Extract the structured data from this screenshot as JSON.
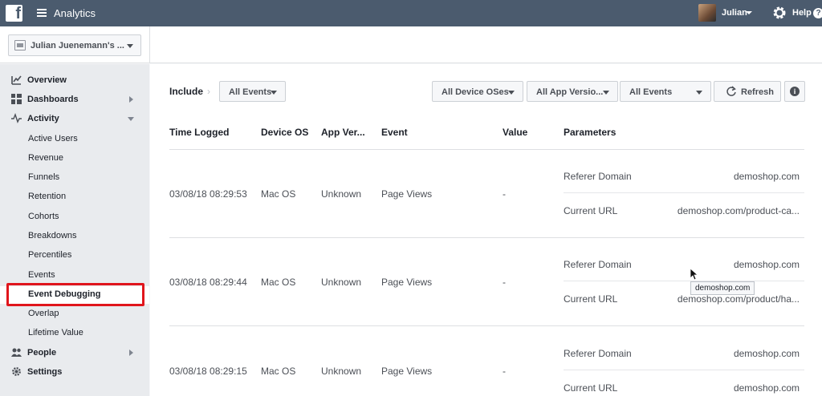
{
  "topbar": {
    "app_title": "Analytics",
    "user_name": "Julian",
    "help_label": "Help",
    "help_symbol": "?"
  },
  "account": {
    "name": "Julian Juenemann's ..."
  },
  "sidebar": {
    "items": [
      {
        "label": "Overview",
        "icon": "overview-icon"
      },
      {
        "label": "Dashboards",
        "icon": "dashboards-icon"
      },
      {
        "label": "Activity",
        "icon": "activity-icon"
      },
      {
        "label": "Active Users"
      },
      {
        "label": "Revenue"
      },
      {
        "label": "Funnels"
      },
      {
        "label": "Retention"
      },
      {
        "label": "Cohorts"
      },
      {
        "label": "Breakdowns"
      },
      {
        "label": "Percentiles"
      },
      {
        "label": "Events"
      },
      {
        "label": "Event Debugging",
        "active": true
      },
      {
        "label": "Overlap"
      },
      {
        "label": "Lifetime Value"
      },
      {
        "label": "People",
        "icon": "people-icon"
      },
      {
        "label": "Settings",
        "icon": "gear-icon"
      }
    ]
  },
  "filters": {
    "include_label": "Include",
    "include_arrow": "›",
    "all_events": "All Events",
    "device_os": "All Device OSes",
    "app_version": "All App Versio...",
    "events": "All Events",
    "refresh": "Refresh"
  },
  "table": {
    "headers": [
      "Time Logged",
      "Device OS",
      "App Ver...",
      "Event",
      "Value",
      "Parameters"
    ],
    "rows": [
      {
        "time": "03/08/18 08:29:53",
        "os": "Mac OS",
        "version": "Unknown",
        "event": "Page Views",
        "value": "-",
        "params": [
          {
            "key": "Referer Domain",
            "value": "demoshop.com"
          },
          {
            "key": "Current URL",
            "value": "demoshop.com/product-ca..."
          }
        ]
      },
      {
        "time": "03/08/18 08:29:44",
        "os": "Mac OS",
        "version": "Unknown",
        "event": "Page Views",
        "value": "-",
        "params": [
          {
            "key": "Referer Domain",
            "value": "demoshop.com"
          },
          {
            "key": "Current URL",
            "value": "demoshop.com/product/ha..."
          }
        ]
      },
      {
        "time": "03/08/18 08:29:15",
        "os": "Mac OS",
        "version": "Unknown",
        "event": "Page Views",
        "value": "-",
        "params": [
          {
            "key": "Referer Domain",
            "value": "demoshop.com"
          },
          {
            "key": "Current URL",
            "value": "demoshop.com"
          }
        ]
      }
    ]
  },
  "tooltip": "demoshop.com",
  "colors": {
    "topbar": "#4b5b6e",
    "highlight": "#e0151c",
    "sidebar": "#e9ebee"
  }
}
